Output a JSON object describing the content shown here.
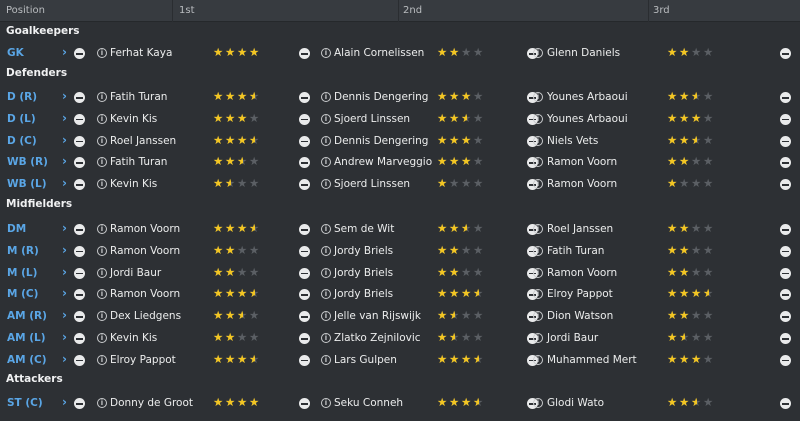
{
  "header": {
    "position": "Position",
    "first": "1st",
    "second": "2nd",
    "third": "3rd"
  },
  "sections": [
    {
      "title": "Goalkeepers",
      "rows": [
        {
          "pos": "GK",
          "p1": "Ferhat Kaya",
          "r1": 4,
          "p2": "Alain Cornelissen",
          "r2": 2,
          "p3": "Glenn Daniels",
          "r3": 2
        }
      ]
    },
    {
      "title": "Defenders",
      "rows": [
        {
          "pos": "D (R)",
          "p1": "Fatih Turan",
          "r1": 3.5,
          "p2": "Dennis Dengering",
          "r2": 3,
          "p3": "Younes Arbaoui",
          "r3": 2.5
        },
        {
          "pos": "D (L)",
          "p1": "Kevin Kis",
          "r1": 3,
          "p2": "Sjoerd Linssen",
          "r2": 2.5,
          "p3": "Younes Arbaoui",
          "r3": 3
        },
        {
          "pos": "D (C)",
          "p1": "Roel Janssen",
          "r1": 3.5,
          "p2": "Dennis Dengering",
          "r2": 3,
          "p3": "Niels Vets",
          "r3": 2.5
        },
        {
          "pos": "WB (R)",
          "p1": "Fatih Turan",
          "r1": 2.5,
          "p2": "Andrew Marveggio",
          "r2": 3,
          "p3": "Ramon Voorn",
          "r3": 2
        },
        {
          "pos": "WB (L)",
          "p1": "Kevin Kis",
          "r1": 1.5,
          "p2": "Sjoerd Linssen",
          "r2": 1,
          "p3": "Ramon Voorn",
          "r3": 1
        }
      ]
    },
    {
      "title": "Midfielders",
      "rows": [
        {
          "pos": "DM",
          "p1": "Ramon Voorn",
          "r1": 3.5,
          "p2": "Sem de Wit",
          "r2": 2.5,
          "p3": "Roel Janssen",
          "r3": 2
        },
        {
          "pos": "M (R)",
          "p1": "Ramon Voorn",
          "r1": 2,
          "p2": "Jordy Briels",
          "r2": 2,
          "p3": "Fatih Turan",
          "r3": 2
        },
        {
          "pos": "M (L)",
          "p1": "Jordi Baur",
          "r1": 2,
          "p2": "Jordy Briels",
          "r2": 2,
          "p3": "Ramon Voorn",
          "r3": 2
        },
        {
          "pos": "M (C)",
          "p1": "Ramon Voorn",
          "r1": 3.5,
          "p2": "Jordy Briels",
          "r2": 3.5,
          "p3": "Elroy Pappot",
          "r3": 3.5
        },
        {
          "pos": "AM (R)",
          "p1": "Dex Liedgens",
          "r1": 2.5,
          "p2": "Jelle van Rijswijk",
          "r2": 1.5,
          "p3": "Dion Watson",
          "r3": 2
        },
        {
          "pos": "AM (L)",
          "p1": "Kevin Kis",
          "r1": 2,
          "p2": "Zlatko Zejnilovic",
          "r2": 1.5,
          "p3": "Jordi Baur",
          "r3": 1.5
        },
        {
          "pos": "AM (C)",
          "p1": "Elroy Pappot",
          "r1": 3.5,
          "p2": "Lars Gulpen",
          "r2": 3.5,
          "p3": "Muhammed Mert",
          "r3": 3
        }
      ]
    },
    {
      "title": "Attackers",
      "rows": [
        {
          "pos": "ST (C)",
          "p1": "Donny de Groot",
          "r1": 4,
          "p2": "Seku Conneh",
          "r2": 3.5,
          "p3": "Glodi Wato",
          "r3": 2.5
        }
      ]
    }
  ],
  "colors": {
    "background": "#2d3034",
    "accent": "#5aa6e6",
    "star": "#f3c623",
    "star_empty": "#5b5f64"
  },
  "icons": {
    "expand": "chevron-right-icon",
    "remove": "minus-circle-icon",
    "info": "info-icon",
    "star": "star-icon"
  }
}
